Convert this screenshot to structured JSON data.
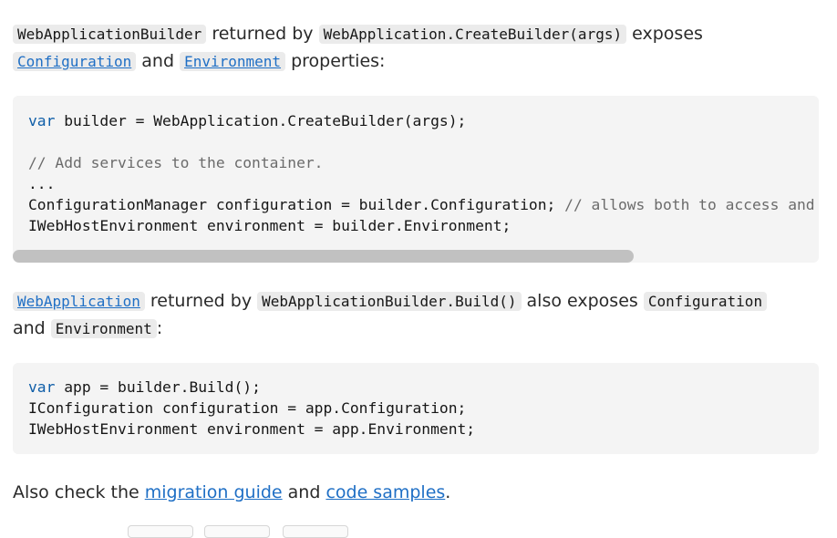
{
  "intro": {
    "code1": "WebApplicationBuilder",
    "t1": " returned by ",
    "code2": "WebApplication.CreateBuilder(args)",
    "t2": " exposes",
    "link1": "Configuration",
    "t3": " and ",
    "link2": "Environment",
    "t4": " properties:"
  },
  "code_block_1": {
    "l1_kw": "var",
    "l1_rest": " builder = WebApplication.CreateBuilder(args);",
    "l3_comment": "// Add services to the container.",
    "l4": "...",
    "l5_code": "ConfigurationManager configuration = builder.Configuration; ",
    "l5_comment": "// allows both to access and to set up the config",
    "l6": "IWebHostEnvironment environment = builder.Environment;"
  },
  "middle": {
    "link1": "WebApplication",
    "t1": " returned by ",
    "code1": "WebApplicationBuilder.Build()",
    "t2": " also exposes ",
    "code2": "Configuration",
    "t3": "and ",
    "code3": "Environment",
    "t4": ":"
  },
  "code_block_2": {
    "l1_kw": "var",
    "l1_rest": " app = builder.Build();",
    "l2": "IConfiguration configuration = app.Configuration;",
    "l3": "IWebHostEnvironment environment = app.Environment;"
  },
  "footer": {
    "t1": "Also check the ",
    "link1": "migration guide",
    "t2": " and ",
    "link2": "code samples",
    "t3": "."
  },
  "scrollbar": {
    "visible_fraction": 0.77,
    "position": 0
  }
}
